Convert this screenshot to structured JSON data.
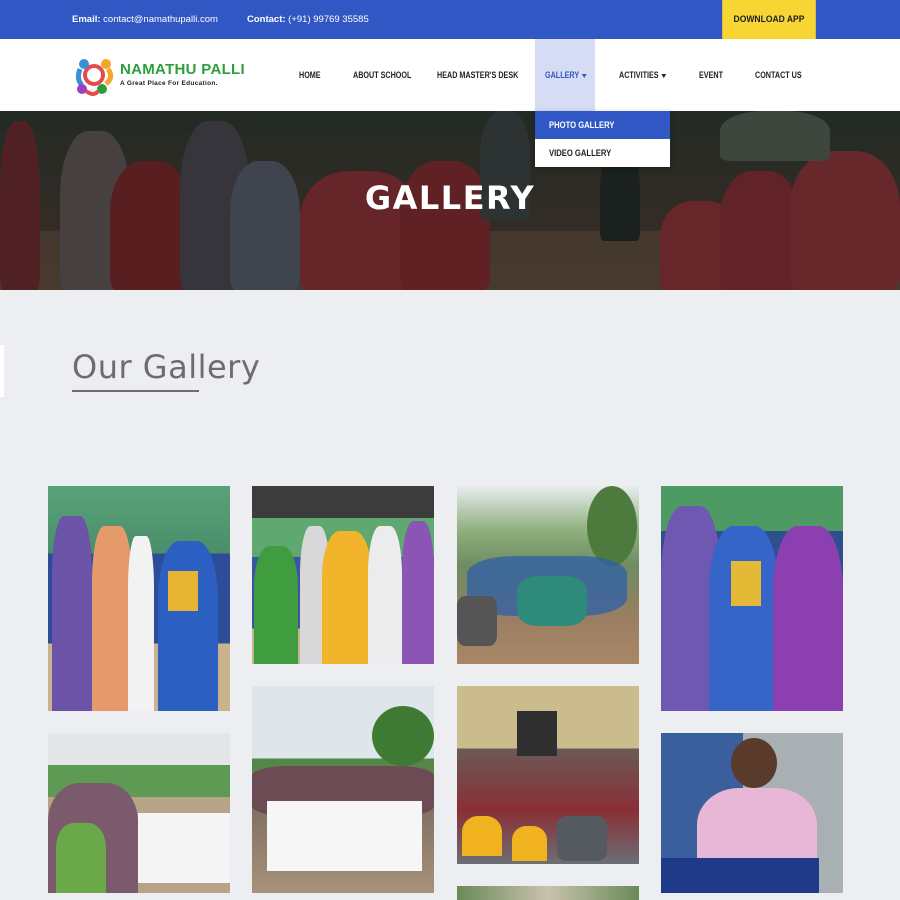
{
  "topbar": {
    "email_label": "Email:",
    "email_value": "contact@namathupalli.com",
    "contact_label": "Contact:",
    "contact_value": "(+91) 99769 35585",
    "download_button": "DOWNLOAD APP"
  },
  "brand": {
    "name": "NAMATHU PALLI",
    "tagline": "A Great Place For Education."
  },
  "nav": {
    "items": [
      {
        "label": "HOME"
      },
      {
        "label": "ABOUT SCHOOL"
      },
      {
        "label": "HEAD MASTER'S DESK"
      },
      {
        "label": "GALLERY"
      },
      {
        "label": "ACTIVITIES"
      },
      {
        "label": "EVENT"
      },
      {
        "label": "CONTACT US"
      }
    ],
    "active": "GALLERY"
  },
  "gallery_dropdown": {
    "items": [
      {
        "label": "PHOTO GALLERY",
        "selected": true
      },
      {
        "label": "VIDEO GALLERY",
        "selected": false
      }
    ]
  },
  "hero": {
    "title": "GALLERY"
  },
  "section": {
    "title": "Our Gallery"
  },
  "colors": {
    "brand_blue": "#3157c4",
    "download_yellow": "#f7d634",
    "logo_green": "#2e9e3c",
    "page_bg": "#eceef2"
  }
}
